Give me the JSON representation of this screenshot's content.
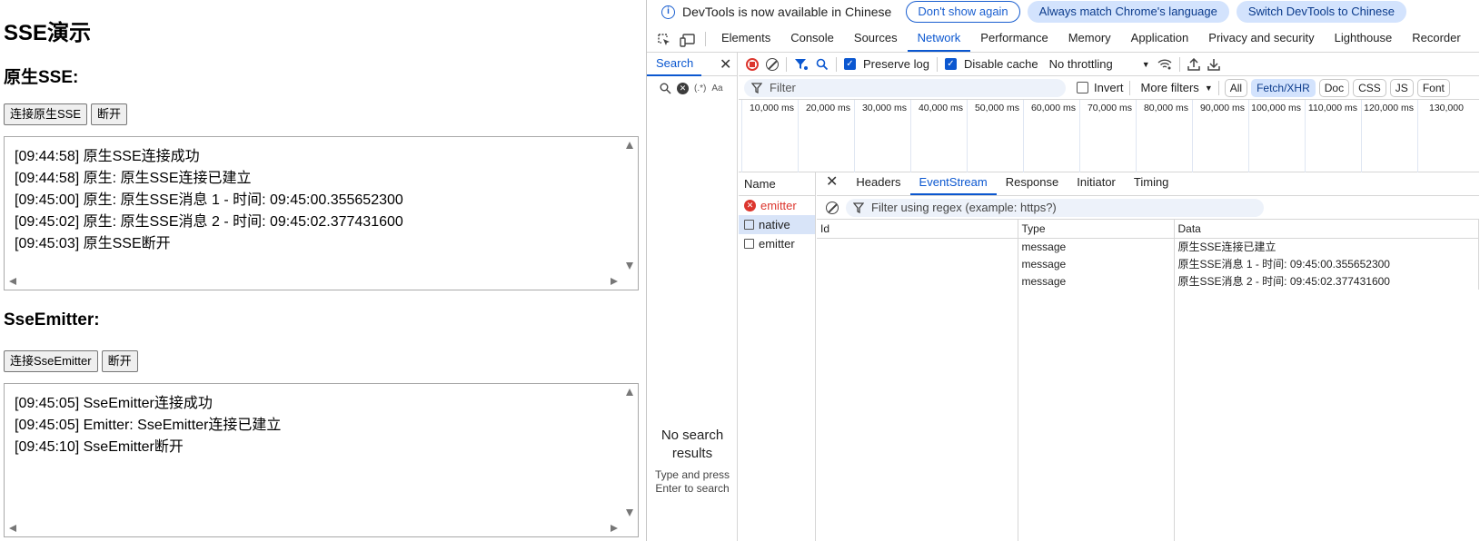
{
  "page": {
    "title": "SSE演示",
    "native": {
      "heading": "原生SSE:",
      "connect_label": "连接原生SSE",
      "disconnect_label": "断开",
      "log": [
        "[09:44:58] 原生SSE连接成功",
        "[09:44:58] 原生: 原生SSE连接已建立",
        "[09:45:00] 原生: 原生SSE消息 1 - 时间: 09:45:00.355652300",
        "[09:45:02] 原生: 原生SSE消息 2 - 时间: 09:45:02.377431600",
        "[09:45:03] 原生SSE断开"
      ]
    },
    "emitter": {
      "heading": "SseEmitter:",
      "connect_label": "连接SseEmitter",
      "disconnect_label": "断开",
      "log": [
        "[09:45:05] SseEmitter连接成功",
        "[09:45:05] Emitter: SseEmitter连接已建立",
        "[09:45:10] SseEmitter断开"
      ]
    }
  },
  "devtools": {
    "infobar": {
      "message": "DevTools is now available in Chinese",
      "dont_show": "Don't show again",
      "always_match": "Always match Chrome's language",
      "switch": "Switch DevTools to Chinese"
    },
    "tabs": [
      "Elements",
      "Console",
      "Sources",
      "Network",
      "Performance",
      "Memory",
      "Application",
      "Privacy and security",
      "Lighthouse",
      "Recorder"
    ],
    "active_tab": "Network",
    "search": {
      "tab_label": "Search",
      "regex_label": "(.*)",
      "case_label": "Aa",
      "no_results": "No search results",
      "hint": "Type and press Enter to search"
    },
    "network": {
      "preserve_log": "Preserve log",
      "disable_cache": "Disable cache",
      "throttling": "No throttling",
      "filter_placeholder": "Filter",
      "invert": "Invert",
      "more_filters": "More filters",
      "chips": [
        "All",
        "Fetch/XHR",
        "Doc",
        "CSS",
        "JS",
        "Font"
      ],
      "active_chip": "Fetch/XHR",
      "timeline_ticks": [
        "10,000 ms",
        "20,000 ms",
        "30,000 ms",
        "40,000 ms",
        "50,000 ms",
        "60,000 ms",
        "70,000 ms",
        "80,000 ms",
        "90,000 ms",
        "100,000 ms",
        "110,000 ms",
        "120,000 ms",
        "130,000"
      ],
      "name_header": "Name",
      "requests": [
        {
          "name": "emitter",
          "status": "error"
        },
        {
          "name": "native",
          "status": "selected"
        },
        {
          "name": "emitter",
          "status": "normal"
        }
      ],
      "detail_tabs": [
        "Headers",
        "EventStream",
        "Response",
        "Initiator",
        "Timing"
      ],
      "active_detail_tab": "EventStream",
      "event_filter_placeholder": "Filter using regex (example: https?)",
      "columns": [
        "Id",
        "Type",
        "Data"
      ],
      "events": [
        {
          "id": "",
          "type": "message",
          "data": "原生SSE连接已建立"
        },
        {
          "id": "",
          "type": "message",
          "data": "原生SSE消息 1 - 时间: 09:45:00.355652300"
        },
        {
          "id": "",
          "type": "message",
          "data": "原生SSE消息 2 - 时间: 09:45:02.377431600"
        }
      ]
    }
  }
}
